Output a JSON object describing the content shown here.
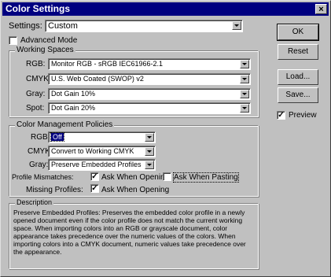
{
  "window": {
    "title": "Color Settings",
    "close_glyph": "×"
  },
  "settings": {
    "label": "Settings:",
    "value": "Custom"
  },
  "advanced_mode": {
    "label": "Advanced Mode",
    "checked": false
  },
  "working_spaces": {
    "title": "Working Spaces",
    "rgb": {
      "label": "RGB:",
      "value": "Monitor RGB - sRGB IEC61966-2.1"
    },
    "cmyk": {
      "label": "CMYK:",
      "value": "U.S. Web Coated (SWOP) v2"
    },
    "gray": {
      "label": "Gray:",
      "value": "Dot Gain 10%"
    },
    "spot": {
      "label": "Spot:",
      "value": "Dot Gain 20%"
    }
  },
  "policies": {
    "title": "Color Management Policies",
    "rgb": {
      "label": "RGB:",
      "value": "Off"
    },
    "cmyk": {
      "label": "CMYK:",
      "value": "Convert to Working CMYK"
    },
    "gray": {
      "label": "Gray:",
      "value": "Preserve Embedded Profiles"
    },
    "mismatches": {
      "label": "Profile Mismatches:",
      "ask_opening": "Ask When Opening",
      "ask_pasting": "Ask When Pasting"
    },
    "missing": {
      "label": "Missing Profiles:",
      "ask_opening": "Ask When Opening"
    }
  },
  "description": {
    "title": "Description",
    "text": "Preserve Embedded Profiles:  Preserves the embedded color profile in a newly opened document even if the color profile does not match the current working space.  When importing colors into an RGB or grayscale document, color appearance takes precedence over the numeric values of the colors. When importing colors into a CMYK document, numeric values take precedence over the appearance."
  },
  "buttons": {
    "ok": "OK",
    "reset": "Reset",
    "load": "Load...",
    "save": "Save..."
  },
  "preview": {
    "label": "Preview",
    "checked": true
  },
  "check_glyph": "✓"
}
